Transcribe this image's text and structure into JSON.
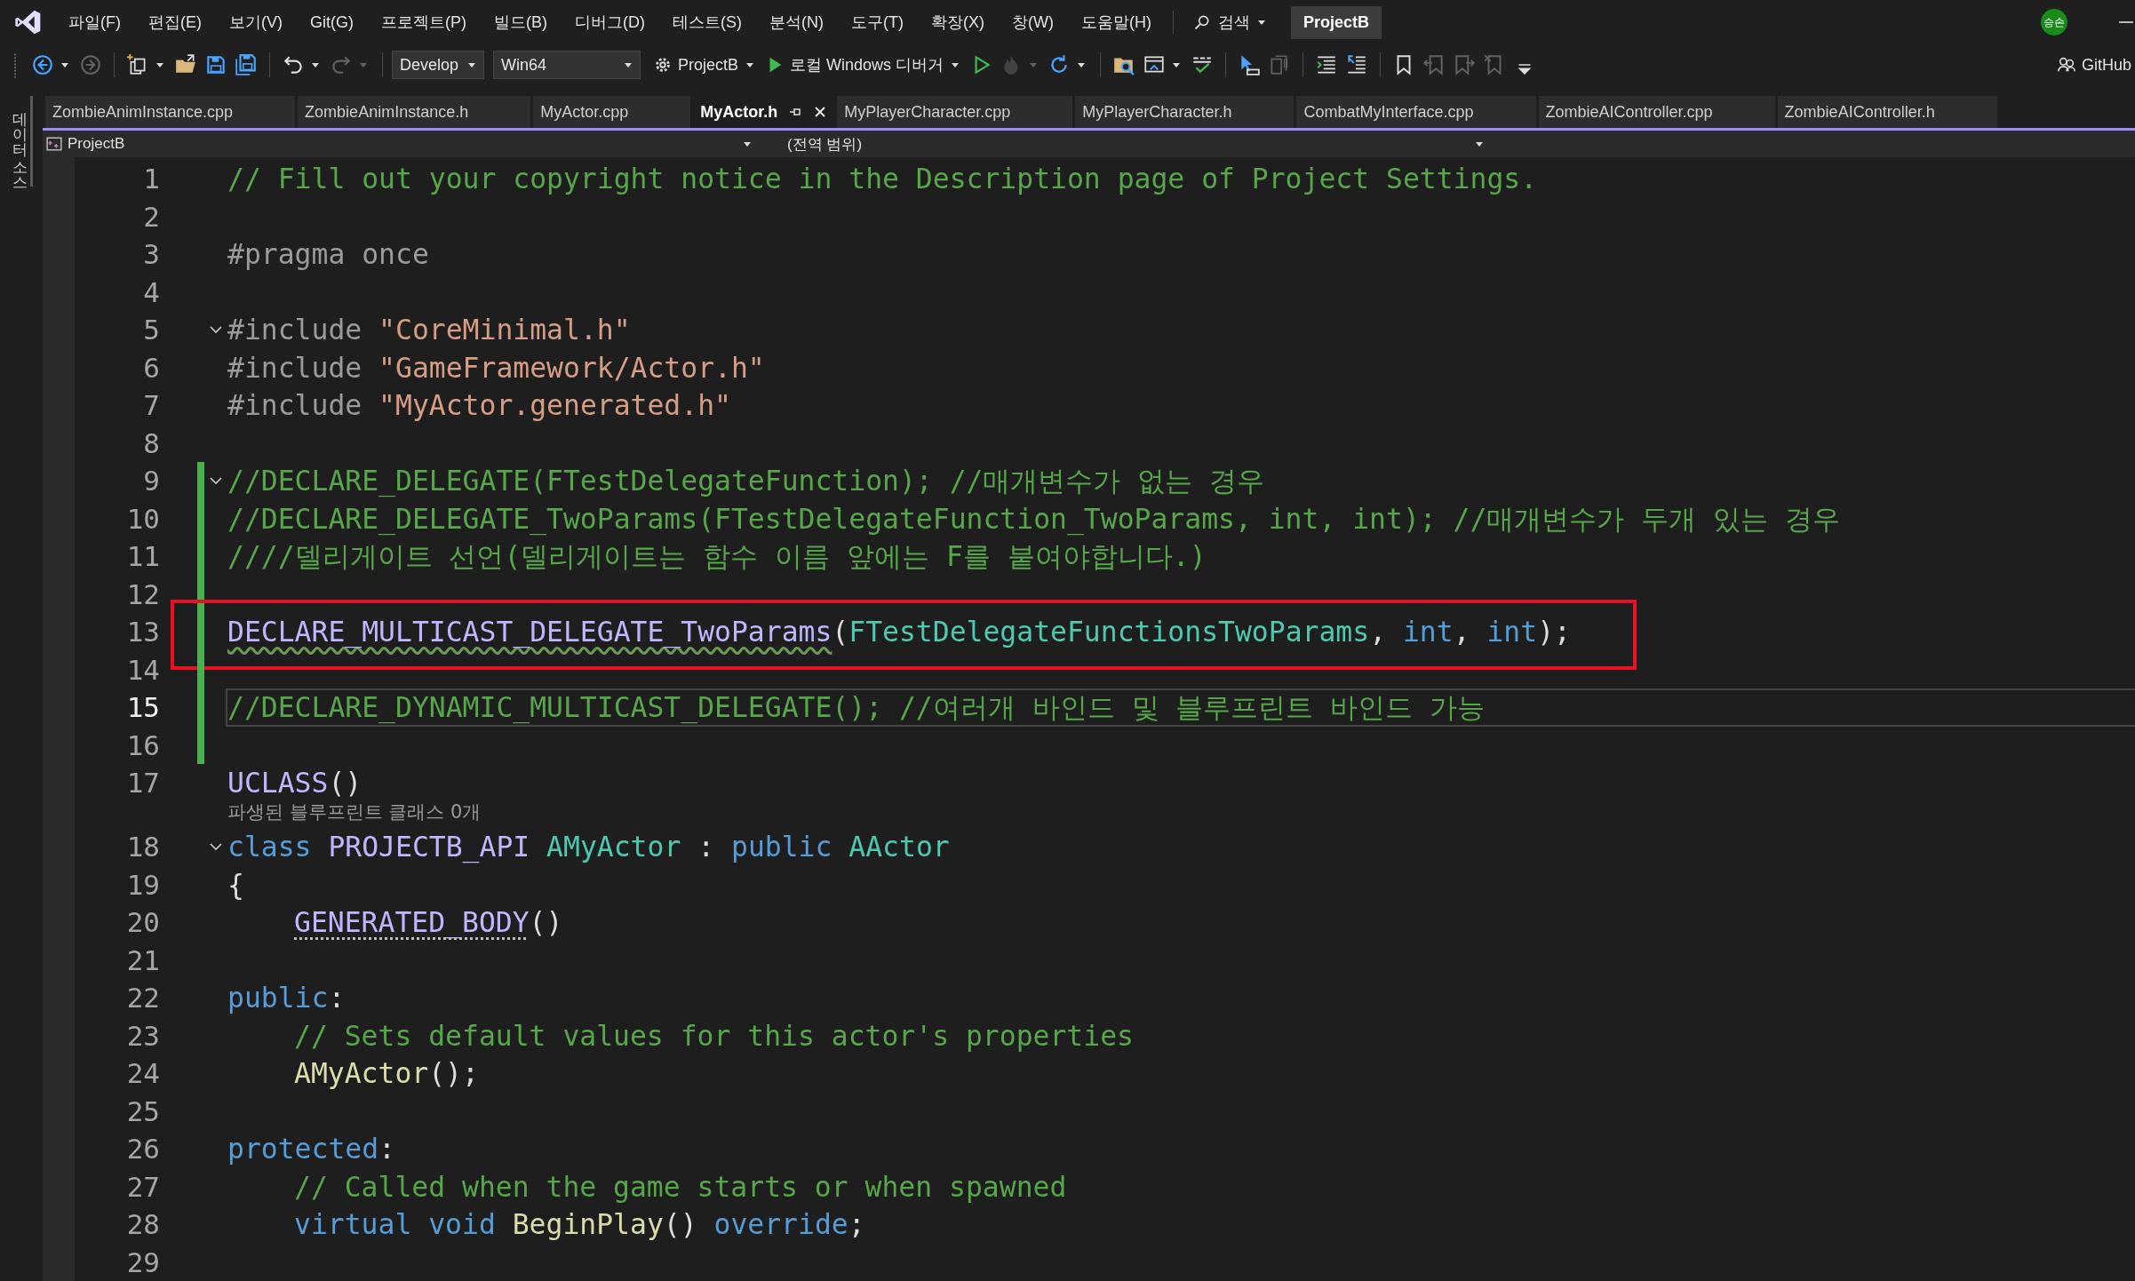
{
  "menu_bar": {
    "items": [
      "파일(F)",
      "편집(E)",
      "보기(V)",
      "Git(G)",
      "프로젝트(P)",
      "빌드(B)",
      "디버그(D)",
      "테스트(S)",
      "분석(N)",
      "도구(T)",
      "확장(X)",
      "창(W)",
      "도움말(H)"
    ],
    "search": "검색",
    "solution_title": "ProjectB",
    "account_initials": "승손"
  },
  "toolbar": {
    "items": [
      {
        "kind": "back",
        "disabled": false,
        "menu": true
      },
      {
        "kind": "forward",
        "disabled": true,
        "menu": false
      },
      {
        "kind": "separator"
      },
      {
        "kind": "new-item",
        "disabled": false,
        "menu": true
      },
      {
        "kind": "open",
        "disabled": false,
        "menu": false
      },
      {
        "kind": "save",
        "disabled": false,
        "menu": false
      },
      {
        "kind": "save-all",
        "disabled": false,
        "menu": false
      },
      {
        "kind": "separator"
      },
      {
        "kind": "undo",
        "disabled": false,
        "menu": true
      },
      {
        "kind": "redo",
        "disabled": true,
        "menu": true
      },
      {
        "kind": "separator"
      },
      {
        "kind": "config-dropdown",
        "label": "Develop"
      },
      {
        "kind": "platform-dropdown",
        "label": "Win64"
      },
      {
        "kind": "startup",
        "label": "ProjectB",
        "menu": true
      },
      {
        "kind": "run",
        "label": "로컬 Windows 디버거",
        "menu": true
      },
      {
        "kind": "run-outline",
        "disabled": false,
        "menu": false
      },
      {
        "kind": "hot-reload",
        "disabled": true,
        "menu": true
      },
      {
        "kind": "restart",
        "disabled": false,
        "menu": true
      },
      {
        "kind": "separator"
      },
      {
        "kind": "find-folder",
        "disabled": false,
        "menu": false
      },
      {
        "kind": "window-layout",
        "disabled": false,
        "menu": true
      },
      {
        "kind": "spell-check",
        "disabled": false,
        "menu": false
      },
      {
        "kind": "separator"
      },
      {
        "kind": "select-tool",
        "disabled": false,
        "menu": false
      },
      {
        "kind": "copy-tool",
        "disabled": true,
        "menu": false
      },
      {
        "kind": "separator"
      },
      {
        "kind": "indent",
        "disabled": false,
        "menu": false
      },
      {
        "kind": "outdent",
        "disabled": false,
        "menu": false
      },
      {
        "kind": "separator"
      },
      {
        "kind": "bookmark",
        "disabled": false,
        "menu": false
      },
      {
        "kind": "bookmark-prev",
        "disabled": true,
        "menu": false
      },
      {
        "kind": "bookmark-next",
        "disabled": true,
        "menu": false
      },
      {
        "kind": "bookmark-clear",
        "disabled": true,
        "menu": false
      },
      {
        "kind": "overflow",
        "disabled": false,
        "menu": false
      }
    ],
    "github": "GitHub"
  },
  "side_tabs": [
    "데이터 소스"
  ],
  "tabs": [
    {
      "label": "ZombieAnimInstance.cpp",
      "selected": false
    },
    {
      "label": "ZombieAnimInstance.h",
      "selected": false
    },
    {
      "label": "MyActor.cpp",
      "selected": false
    },
    {
      "label": "MyActor.h",
      "selected": true
    },
    {
      "label": "MyPlayerCharacter.cpp",
      "selected": false
    },
    {
      "label": "MyPlayerCharacter.h",
      "selected": false
    },
    {
      "label": "CombatMyInterface.cpp",
      "selected": false
    },
    {
      "label": "ZombieAIController.cpp",
      "selected": false
    },
    {
      "label": "ZombieAIController.h",
      "selected": false
    }
  ],
  "navigation_bar": {
    "project": "ProjectB",
    "scope": "(전역 범위)"
  },
  "editor": {
    "lines": [
      {
        "number": "1",
        "changed": false,
        "current": false,
        "boxed": false,
        "foldable": false,
        "tokens": [
          {
            "kind": "comment",
            "text": "// Fill out your copyright notice in the Description page of Project Settings."
          }
        ]
      },
      {
        "number": "2",
        "changed": false,
        "current": false,
        "boxed": false,
        "foldable": false
      },
      {
        "number": "3",
        "changed": false,
        "current": false,
        "boxed": false,
        "foldable": false,
        "tokens": [
          {
            "kind": "preproc",
            "text": "#pragma once"
          }
        ]
      },
      {
        "number": "4",
        "changed": false,
        "current": false,
        "boxed": false,
        "foldable": false
      },
      {
        "number": "5",
        "changed": false,
        "current": false,
        "boxed": false,
        "foldable": true,
        "tokens": [
          {
            "kind": "preproc",
            "text": "#include "
          },
          {
            "kind": "string",
            "text": "\"CoreMinimal.h\""
          }
        ]
      },
      {
        "number": "6",
        "changed": false,
        "current": false,
        "boxed": false,
        "foldable": false,
        "tokens": [
          {
            "kind": "preproc",
            "text": "#include "
          },
          {
            "kind": "string",
            "text": "\"GameFramework/Actor.h\""
          }
        ]
      },
      {
        "number": "7",
        "changed": false,
        "current": false,
        "boxed": false,
        "foldable": false,
        "tokens": [
          {
            "kind": "preproc",
            "text": "#include "
          },
          {
            "kind": "string",
            "text": "\"MyActor.generated.h\""
          }
        ]
      },
      {
        "number": "8",
        "changed": false,
        "current": false,
        "boxed": false,
        "foldable": false
      },
      {
        "number": "9",
        "changed": true,
        "current": false,
        "boxed": false,
        "foldable": true,
        "tokens": [
          {
            "kind": "comment",
            "text": "//DECLARE_DELEGATE(FTestDelegateFunction); //매개변수가 없는 경우"
          }
        ]
      },
      {
        "number": "10",
        "changed": true,
        "current": false,
        "boxed": false,
        "foldable": false,
        "tokens": [
          {
            "kind": "comment",
            "text": "//DECLARE_DELEGATE_TwoParams(FTestDelegateFunction_TwoParams, int, int); //매개변수가 두개 있는 경우"
          }
        ]
      },
      {
        "number": "11",
        "changed": true,
        "current": false,
        "boxed": false,
        "foldable": false,
        "tokens": [
          {
            "kind": "comment",
            "text": "////델리게이트 선언(델리게이트는 함수 이름 앞에는 F를 붙여야합니다.)"
          }
        ]
      },
      {
        "number": "12",
        "changed": true,
        "current": false,
        "boxed": false,
        "foldable": false
      },
      {
        "number": "13",
        "changed": true,
        "current": false,
        "boxed": true,
        "foldable": false,
        "tokens": [
          {
            "kind": "macro",
            "text": "DECLARE_MULTICAST_DELEGATE_TwoParams",
            "squiggle": true
          },
          {
            "kind": "punct",
            "text": "("
          },
          {
            "kind": "type",
            "text": "FTestDelegateFunctionsTwoParams"
          },
          {
            "kind": "punct",
            "text": ", "
          },
          {
            "kind": "keyword",
            "text": "int"
          },
          {
            "kind": "punct",
            "text": ", "
          },
          {
            "kind": "keyword",
            "text": "int"
          },
          {
            "kind": "punct",
            "text": ");"
          }
        ]
      },
      {
        "number": "14",
        "changed": true,
        "current": false,
        "boxed": false,
        "foldable": false
      },
      {
        "number": "15",
        "changed": true,
        "current": true,
        "boxed": false,
        "foldable": false,
        "tokens": [
          {
            "kind": "comment",
            "text": "//DECLARE_DYNAMIC_MULTICAST_DELEGATE(); //여러개 바인드 및 블루프린트 바인드 가능"
          }
        ]
      },
      {
        "number": "16",
        "changed": true,
        "current": false,
        "boxed": false,
        "foldable": false
      },
      {
        "number": "17",
        "changed": false,
        "current": false,
        "boxed": false,
        "foldable": false,
        "tokens": [
          {
            "kind": "macro",
            "text": "UCLASS"
          },
          {
            "kind": "punct",
            "text": "()"
          }
        ],
        "codelens": "파생된 블루프린트 클래스 0개"
      },
      {
        "number": "18",
        "changed": false,
        "current": false,
        "boxed": false,
        "foldable": true,
        "tokens": [
          {
            "kind": "keyword",
            "text": "class "
          },
          {
            "kind": "macro",
            "text": "PROJECTB_API "
          },
          {
            "kind": "type",
            "text": "AMyActor"
          },
          {
            "kind": "punct",
            "text": " : "
          },
          {
            "kind": "keyword",
            "text": "public "
          },
          {
            "kind": "type",
            "text": "AActor"
          }
        ]
      },
      {
        "number": "19",
        "changed": false,
        "current": false,
        "boxed": false,
        "foldable": false,
        "tokens": [
          {
            "kind": "punct",
            "text": "{"
          }
        ]
      },
      {
        "number": "20",
        "changed": false,
        "current": false,
        "boxed": false,
        "foldable": false,
        "indented": true,
        "tokens": [
          {
            "kind": "macro",
            "text": "GENERATED_BODY",
            "dotted_hint": true
          },
          {
            "kind": "punct",
            "text": "()"
          }
        ]
      },
      {
        "number": "21",
        "changed": false,
        "current": false,
        "boxed": false,
        "foldable": false
      },
      {
        "number": "22",
        "changed": false,
        "current": false,
        "boxed": false,
        "foldable": false,
        "tokens": [
          {
            "kind": "keyword",
            "text": "public"
          },
          {
            "kind": "punct",
            "text": ":"
          }
        ]
      },
      {
        "number": "23",
        "changed": false,
        "current": false,
        "boxed": false,
        "foldable": false,
        "indented": true,
        "tokens": [
          {
            "kind": "comment",
            "text": "// Sets default values for this actor's properties"
          }
        ]
      },
      {
        "number": "24",
        "changed": false,
        "current": false,
        "boxed": false,
        "foldable": false,
        "indented": true,
        "tokens": [
          {
            "kind": "function",
            "text": "AMyActor"
          },
          {
            "kind": "punct",
            "text": "();"
          }
        ]
      },
      {
        "number": "25",
        "changed": false,
        "current": false,
        "boxed": false,
        "foldable": false
      },
      {
        "number": "26",
        "changed": false,
        "current": false,
        "boxed": false,
        "foldable": false,
        "tokens": [
          {
            "kind": "keyword",
            "text": "protected"
          },
          {
            "kind": "punct",
            "text": ":"
          }
        ]
      },
      {
        "number": "27",
        "changed": false,
        "current": false,
        "boxed": false,
        "foldable": false,
        "indented": true,
        "tokens": [
          {
            "kind": "comment",
            "text": "// Called when the game starts or when spawned"
          }
        ]
      },
      {
        "number": "28",
        "changed": false,
        "current": false,
        "boxed": false,
        "foldable": false,
        "indented": true,
        "tokens": [
          {
            "kind": "keyword",
            "text": "virtual void "
          },
          {
            "kind": "function",
            "text": "BeginPlay"
          },
          {
            "kind": "punct",
            "text": "() "
          },
          {
            "kind": "keyword",
            "text": "override"
          },
          {
            "kind": "punct",
            "text": ";"
          }
        ]
      },
      {
        "number": "29",
        "changed": false,
        "current": false,
        "boxed": false,
        "foldable": false
      }
    ]
  }
}
